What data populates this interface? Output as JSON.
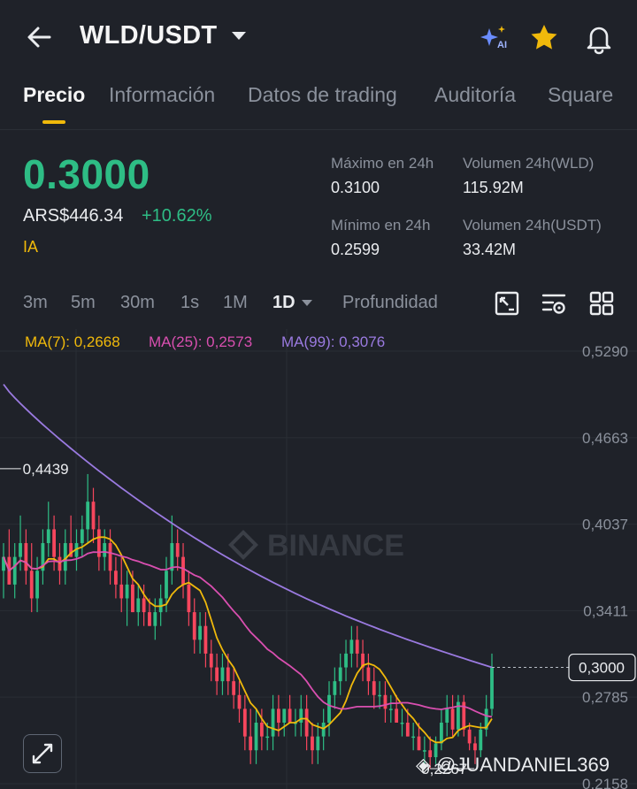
{
  "header": {
    "pair": "WLD/USDT",
    "icons": [
      "back-arrow-icon",
      "ai-sparkle-icon",
      "star-icon",
      "bell-icon"
    ]
  },
  "tabs": [
    {
      "label": "Precio",
      "active": true
    },
    {
      "label": "Información",
      "active": false
    },
    {
      "label": "Datos de trading",
      "active": false
    },
    {
      "label": "Auditoría",
      "active": false
    },
    {
      "label": "Square",
      "active": false
    }
  ],
  "ticker": {
    "price": "0.3000",
    "fiat": "ARS$446.34",
    "change": "+10.62%",
    "tag": "IA",
    "high_label": "Máximo en 24h",
    "high_value": "0.3100",
    "low_label": "Mínimo en 24h",
    "low_value": "0.2599",
    "vol_base_label": "Volumen 24h(WLD)",
    "vol_base_value": "115.92M",
    "vol_quote_label": "Volumen 24h(USDT)",
    "vol_quote_value": "33.42M"
  },
  "intervals": [
    {
      "label": "3m"
    },
    {
      "label": "5m"
    },
    {
      "label": "30m"
    },
    {
      "label": "1s"
    },
    {
      "label": "1M"
    },
    {
      "label": "1D",
      "active": true
    },
    {
      "label": "Profundidad"
    }
  ],
  "ma_legend": {
    "ma7": "MA(7): 0,2668",
    "ma25": "MA(25): 0,2573",
    "ma99": "MA(99): 0,3076"
  },
  "chart_labels": {
    "axis": [
      "0,5290",
      "0,4663",
      "0,4037",
      "0,3411",
      "0,2785",
      "0,2158"
    ],
    "current": "0,3000",
    "high_marker": "0,4439",
    "low_marker": "0,2267",
    "watermark_brand": "BINANCE",
    "watermark_user": "@JUANDANIEL369"
  },
  "colors": {
    "up": "#2ebd85",
    "down": "#f6465d",
    "ma7": "#f0b90b",
    "ma25": "#d94fb0",
    "ma99": "#9a7ae0",
    "accent": "#f0b90b"
  },
  "chart_data": {
    "type": "candlestick",
    "ylim": [
      0.2158,
      0.529
    ],
    "yticks": [
      0.529,
      0.4663,
      0.4037,
      0.3411,
      0.2785,
      0.2158
    ],
    "grid": true,
    "last_price": 0.3,
    "high_marker": 0.4439,
    "low_marker": 0.2267,
    "candles": [
      [
        0.37,
        0.39,
        0.35,
        0.38
      ],
      [
        0.38,
        0.4,
        0.36,
        0.36
      ],
      [
        0.36,
        0.39,
        0.35,
        0.38
      ],
      [
        0.38,
        0.41,
        0.37,
        0.39
      ],
      [
        0.39,
        0.4,
        0.36,
        0.37
      ],
      [
        0.37,
        0.39,
        0.34,
        0.35
      ],
      [
        0.35,
        0.38,
        0.34,
        0.37
      ],
      [
        0.37,
        0.4,
        0.36,
        0.39
      ],
      [
        0.39,
        0.42,
        0.38,
        0.4
      ],
      [
        0.4,
        0.41,
        0.37,
        0.38
      ],
      [
        0.38,
        0.39,
        0.36,
        0.37
      ],
      [
        0.37,
        0.4,
        0.36,
        0.39
      ],
      [
        0.39,
        0.41,
        0.38,
        0.38
      ],
      [
        0.38,
        0.4,
        0.37,
        0.39
      ],
      [
        0.39,
        0.41,
        0.38,
        0.4
      ],
      [
        0.4,
        0.44,
        0.39,
        0.42
      ],
      [
        0.42,
        0.43,
        0.39,
        0.4
      ],
      [
        0.4,
        0.41,
        0.37,
        0.38
      ],
      [
        0.38,
        0.4,
        0.37,
        0.39
      ],
      [
        0.39,
        0.4,
        0.36,
        0.37
      ],
      [
        0.37,
        0.38,
        0.35,
        0.36
      ],
      [
        0.36,
        0.38,
        0.34,
        0.35
      ],
      [
        0.35,
        0.37,
        0.33,
        0.36
      ],
      [
        0.36,
        0.37,
        0.34,
        0.34
      ],
      [
        0.34,
        0.36,
        0.33,
        0.35
      ],
      [
        0.35,
        0.36,
        0.33,
        0.34
      ],
      [
        0.34,
        0.35,
        0.33,
        0.33
      ],
      [
        0.33,
        0.35,
        0.32,
        0.34
      ],
      [
        0.34,
        0.36,
        0.33,
        0.35
      ],
      [
        0.35,
        0.38,
        0.34,
        0.37
      ],
      [
        0.37,
        0.41,
        0.36,
        0.39
      ],
      [
        0.39,
        0.4,
        0.37,
        0.38
      ],
      [
        0.38,
        0.39,
        0.35,
        0.36
      ],
      [
        0.36,
        0.37,
        0.33,
        0.34
      ],
      [
        0.34,
        0.35,
        0.31,
        0.32
      ],
      [
        0.32,
        0.34,
        0.31,
        0.33
      ],
      [
        0.33,
        0.34,
        0.3,
        0.31
      ],
      [
        0.31,
        0.32,
        0.29,
        0.3
      ],
      [
        0.3,
        0.31,
        0.28,
        0.29
      ],
      [
        0.29,
        0.31,
        0.28,
        0.3
      ],
      [
        0.3,
        0.31,
        0.28,
        0.29
      ],
      [
        0.29,
        0.3,
        0.27,
        0.28
      ],
      [
        0.28,
        0.29,
        0.26,
        0.27
      ],
      [
        0.27,
        0.28,
        0.24,
        0.25
      ],
      [
        0.25,
        0.27,
        0.23,
        0.24
      ],
      [
        0.24,
        0.27,
        0.23,
        0.26
      ],
      [
        0.26,
        0.27,
        0.24,
        0.25
      ],
      [
        0.25,
        0.26,
        0.24,
        0.25
      ],
      [
        0.25,
        0.28,
        0.24,
        0.27
      ],
      [
        0.27,
        0.28,
        0.25,
        0.26
      ],
      [
        0.26,
        0.27,
        0.25,
        0.27
      ],
      [
        0.27,
        0.28,
        0.26,
        0.26
      ],
      [
        0.26,
        0.27,
        0.25,
        0.26
      ],
      [
        0.26,
        0.28,
        0.25,
        0.27
      ],
      [
        0.27,
        0.28,
        0.24,
        0.25
      ],
      [
        0.25,
        0.26,
        0.23,
        0.24
      ],
      [
        0.24,
        0.26,
        0.23,
        0.25
      ],
      [
        0.25,
        0.27,
        0.24,
        0.26
      ],
      [
        0.26,
        0.29,
        0.25,
        0.28
      ],
      [
        0.28,
        0.3,
        0.27,
        0.29
      ],
      [
        0.29,
        0.31,
        0.28,
        0.3
      ],
      [
        0.3,
        0.32,
        0.29,
        0.31
      ],
      [
        0.31,
        0.33,
        0.3,
        0.32
      ],
      [
        0.32,
        0.33,
        0.3,
        0.31
      ],
      [
        0.31,
        0.32,
        0.29,
        0.3
      ],
      [
        0.3,
        0.31,
        0.28,
        0.29
      ],
      [
        0.29,
        0.3,
        0.27,
        0.28
      ],
      [
        0.28,
        0.29,
        0.27,
        0.28
      ],
      [
        0.28,
        0.29,
        0.26,
        0.27
      ],
      [
        0.27,
        0.28,
        0.26,
        0.27
      ],
      [
        0.27,
        0.28,
        0.26,
        0.26
      ],
      [
        0.26,
        0.27,
        0.25,
        0.26
      ],
      [
        0.26,
        0.27,
        0.25,
        0.25
      ],
      [
        0.25,
        0.26,
        0.24,
        0.25
      ],
      [
        0.25,
        0.26,
        0.24,
        0.24
      ],
      [
        0.24,
        0.25,
        0.23,
        0.24
      ],
      [
        0.24,
        0.25,
        0.2267,
        0.235
      ],
      [
        0.235,
        0.25,
        0.23,
        0.245
      ],
      [
        0.245,
        0.27,
        0.24,
        0.26
      ],
      [
        0.26,
        0.28,
        0.25,
        0.27
      ],
      [
        0.27,
        0.28,
        0.25,
        0.255
      ],
      [
        0.255,
        0.28,
        0.25,
        0.275
      ],
      [
        0.275,
        0.28,
        0.25,
        0.255
      ],
      [
        0.255,
        0.26,
        0.24,
        0.245
      ],
      [
        0.245,
        0.25,
        0.23,
        0.24
      ],
      [
        0.24,
        0.26,
        0.235,
        0.255
      ],
      [
        0.255,
        0.28,
        0.25,
        0.27
      ],
      [
        0.27,
        0.31,
        0.265,
        0.3
      ]
    ]
  }
}
